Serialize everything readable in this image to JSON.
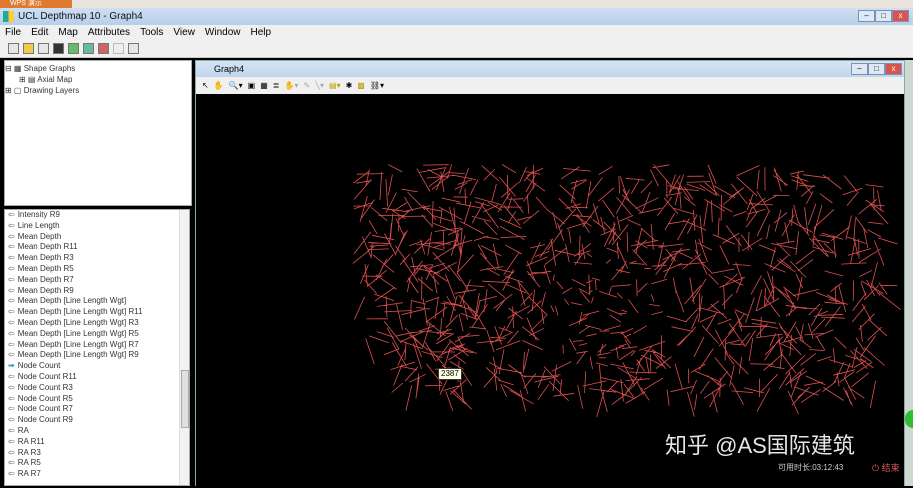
{
  "taskbar": {
    "label": "WPS 演示"
  },
  "app": {
    "title": "UCL Depthmap 10 - Graph4"
  },
  "menu": [
    "File",
    "Edit",
    "Map",
    "Attributes",
    "Tools",
    "View",
    "Window",
    "Help"
  ],
  "tree": {
    "shape_graphs": "Shape Graphs",
    "axial_map": "Axial Map",
    "drawing_layers": "Drawing Layers"
  },
  "attributes": [
    "Intensity R9",
    "Line Length",
    "Mean Depth",
    "Mean Depth R11",
    "Mean Depth R3",
    "Mean Depth R5",
    "Mean Depth R7",
    "Mean Depth R9",
    "Mean Depth [Line Length Wgt]",
    "Mean Depth [Line Length Wgt] R11",
    "Mean Depth [Line Length Wgt] R3",
    "Mean Depth [Line Length Wgt] R5",
    "Mean Depth [Line Length Wgt] R7",
    "Mean Depth [Line Length Wgt] R9",
    "Node Count",
    "Node Count R11",
    "Node Count R3",
    "Node Count R5",
    "Node Count R7",
    "Node Count R9",
    "RA",
    "RA R11",
    "RA R3",
    "RA R5",
    "RA R7"
  ],
  "selected_attribute": "Node Count",
  "graph": {
    "title": "Graph4",
    "tooltip": "2387",
    "line_color": "#e05050"
  },
  "overlay": {
    "watermark": "知乎 @AS国际建筑",
    "timer": "可用时长:03:12:43",
    "end": "结束"
  }
}
